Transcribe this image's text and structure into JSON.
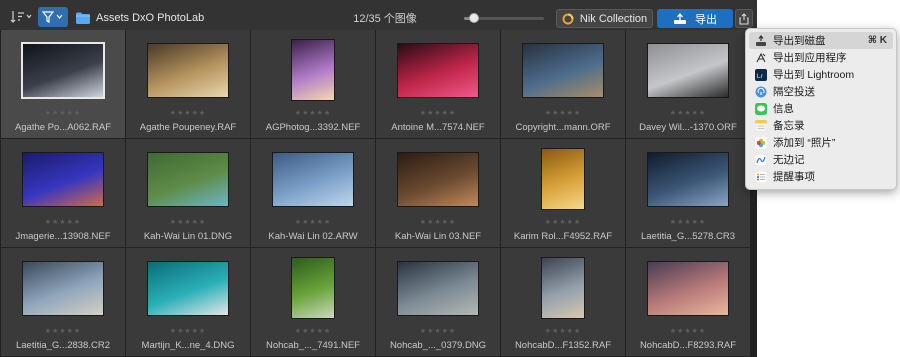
{
  "toolbar": {
    "folder_name": "Assets DxO PhotoLab",
    "image_counter": "12/35 个图像",
    "zoom_level": 0.12,
    "nik_collection_label": "Nik Collection",
    "export_label": "导出",
    "colors": {
      "accent": "#1f6fc0",
      "filter_active": "#2f6fb0",
      "folder": "#5aa8f0"
    }
  },
  "grid": {
    "rows": [
      [
        {
          "filename": "Agathe Po...A062.RAF",
          "stars": "★★★★★",
          "selected": true,
          "colors": [
            "#101418",
            "#3a3f4a",
            "#cfd5dd"
          ],
          "shape": "landscape"
        },
        {
          "filename": "Agathe Poupeney.RAF",
          "stars": "★★★★★",
          "selected": false,
          "colors": [
            "#4a3a28",
            "#b5945e",
            "#e8d7b0"
          ],
          "shape": "landscape"
        },
        {
          "filename": "AGPhotog...3392.NEF",
          "stars": "★★★★★",
          "selected": false,
          "colors": [
            "#3a2048",
            "#b07ac8",
            "#f1d8b0"
          ],
          "shape": "portrait"
        },
        {
          "filename": "Antoine M...7574.NEF",
          "stars": "★★★★★",
          "selected": false,
          "colors": [
            "#2a0c14",
            "#c0264a",
            "#f05a8a"
          ],
          "shape": "landscape"
        },
        {
          "filename": "Copyright...mann.ORF",
          "stars": "★★★★★",
          "selected": false,
          "colors": [
            "#28323e",
            "#4c6c8c",
            "#a88e6a"
          ],
          "shape": "landscape"
        },
        {
          "filename": "Davey Wil...-1370.ORF",
          "stars": "★★★★★",
          "selected": false,
          "colors": [
            "#8d8f93",
            "#c4c6c9",
            "#2a2a2a"
          ],
          "shape": "landscape"
        }
      ],
      [
        {
          "filename": "Jmagerie...13908.NEF",
          "stars": "★★★★★",
          "selected": false,
          "colors": [
            "#1b1b6a",
            "#3636c0",
            "#d06a4a"
          ],
          "shape": "landscape"
        },
        {
          "filename": "Kah-Wai Lin 01.DNG",
          "stars": "★★★★★",
          "selected": false,
          "colors": [
            "#3f6a34",
            "#5e8c48",
            "#6fb4c8"
          ],
          "shape": "landscape"
        },
        {
          "filename": "Kah-Wai Lin 02.ARW",
          "stars": "★★★★★",
          "selected": false,
          "colors": [
            "#3c5a84",
            "#7aa0c8",
            "#c0d6ea"
          ],
          "shape": "landscape"
        },
        {
          "filename": "Kah-Wai Lin 03.NEF",
          "stars": "★★★★★",
          "selected": false,
          "colors": [
            "#2c1c12",
            "#6a4a30",
            "#c08a5a"
          ],
          "shape": "landscape"
        },
        {
          "filename": "Karim Rol...F4952.RAF",
          "stars": "★★★★★",
          "selected": false,
          "colors": [
            "#8a5a10",
            "#d8a23a",
            "#f6d88a"
          ],
          "shape": "portrait"
        },
        {
          "filename": "Laetitia_G...5278.CR3",
          "stars": "★★★★★",
          "selected": false,
          "colors": [
            "#101c2c",
            "#3c5676",
            "#8aa6c4"
          ],
          "shape": "landscape"
        }
      ],
      [
        {
          "filename": "Laetitia_G...2838.CR2",
          "stars": "★★★★★",
          "selected": false,
          "colors": [
            "#3a4a5c",
            "#8fa6bc",
            "#d4d0c4"
          ],
          "shape": "landscape"
        },
        {
          "filename": "Martijn_K...ne_4.DNG",
          "stars": "★★★★★",
          "selected": false,
          "colors": [
            "#0a6c78",
            "#2ab0b8",
            "#e6e6e6"
          ],
          "shape": "landscape"
        },
        {
          "filename": "Nohcab_..._7491.NEF",
          "stars": "★★★★★",
          "selected": false,
          "colors": [
            "#2c5c1c",
            "#6aa43a",
            "#cbd8c0"
          ],
          "shape": "portrait"
        },
        {
          "filename": "Nohcab_..._0379.DNG",
          "stars": "★★★★★",
          "selected": false,
          "colors": [
            "#2a3440",
            "#7c8a94",
            "#b4b8b4"
          ],
          "shape": "landscape"
        },
        {
          "filename": "NohcabD...F1352.RAF",
          "stars": "★★★★★",
          "selected": false,
          "colors": [
            "#3c4450",
            "#94a0ac",
            "#d8c8b0"
          ],
          "shape": "portrait"
        },
        {
          "filename": "NohcabD...F8293.RAF",
          "stars": "★★★★★",
          "selected": false,
          "colors": [
            "#4a3c54",
            "#b87a7a",
            "#e8b89c"
          ],
          "shape": "landscape"
        }
      ]
    ]
  },
  "export_menu": {
    "items": [
      {
        "label": "导出到磁盘",
        "icon": "export-disk-icon",
        "shortcut": "⌘ K",
        "highlighted": true
      },
      {
        "label": "导出到应用程序",
        "icon": "app-icon",
        "shortcut": "",
        "highlighted": false
      },
      {
        "label": "导出到 Lightroom",
        "icon": "lightroom-icon",
        "shortcut": "",
        "highlighted": false
      },
      {
        "label": "隔空投送",
        "icon": "airdrop-icon",
        "shortcut": "",
        "highlighted": false
      },
      {
        "label": "信息",
        "icon": "messages-icon",
        "shortcut": "",
        "highlighted": false
      },
      {
        "label": "备忘录",
        "icon": "notes-icon",
        "shortcut": "",
        "highlighted": false
      },
      {
        "label": "添加到 “照片”",
        "icon": "photos-icon",
        "shortcut": "",
        "highlighted": false
      },
      {
        "label": "无边记",
        "icon": "freeform-icon",
        "shortcut": "",
        "highlighted": false
      },
      {
        "label": "提醒事项",
        "icon": "reminders-icon",
        "shortcut": "",
        "highlighted": false
      }
    ]
  }
}
